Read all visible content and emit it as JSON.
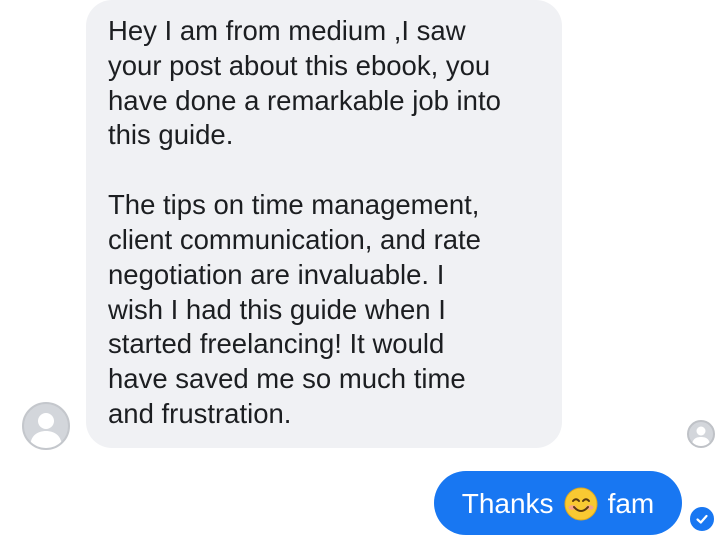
{
  "incoming_message": {
    "paragraph_1": "Hey I am from medium ,I saw\nyour post about this ebook, you\nhave done a remarkable job into\nthis guide.",
    "paragraph_2": "The tips on time management,\nclient communication, and rate\nnegotiation are invaluable. I\nwish I had this guide when I\nstarted freelancing! It would\nhave saved me so much time\nand frustration."
  },
  "outgoing_message": {
    "text_before_emoji": "Thanks",
    "emoji_icon": "smiling-face-icon",
    "text_after_emoji": "fam"
  },
  "colors": {
    "incoming_bubble": "#f0f1f4",
    "outgoing_bubble": "#1877f2",
    "text_dark": "#1c1e21",
    "avatar_placeholder": "#d3d6db"
  },
  "icons": {
    "sender_avatar": "default-avatar-icon",
    "seen_indicator": "seen-avatar-icon",
    "sent_status": "checkmark-circle-icon"
  }
}
